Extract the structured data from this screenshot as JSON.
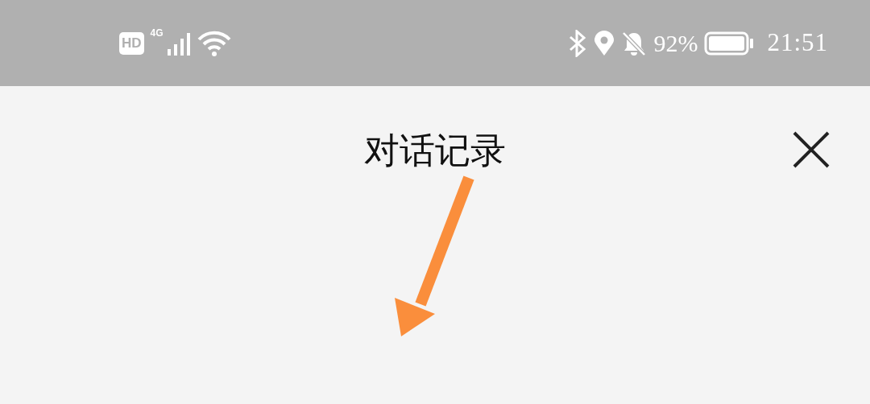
{
  "status_bar": {
    "hd_badge": "HD",
    "network": "4G",
    "battery_percent": "92%",
    "time": "21:51"
  },
  "header": {
    "title": "对话记录"
  }
}
